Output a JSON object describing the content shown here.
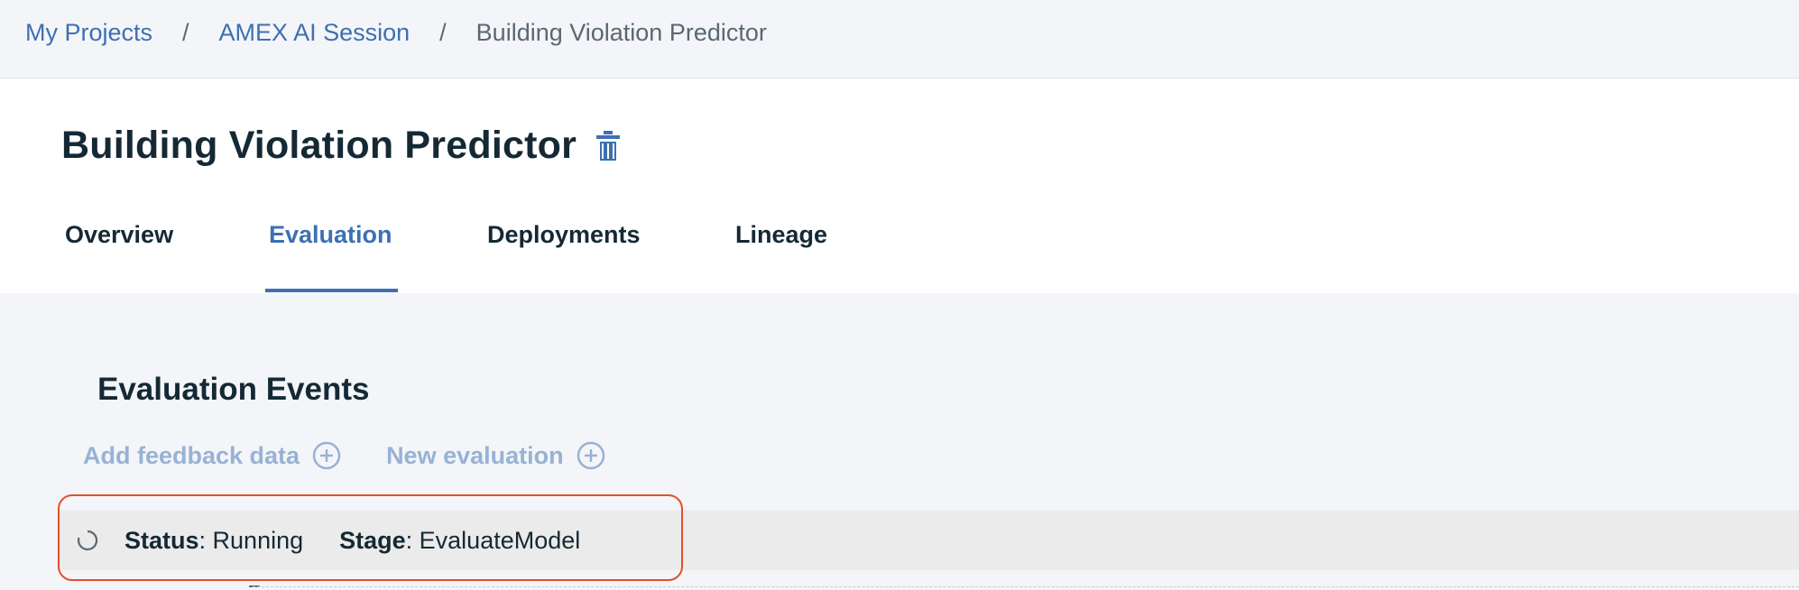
{
  "breadcrumb": {
    "items": [
      {
        "label": "My Projects"
      },
      {
        "label": "AMEX AI Session"
      },
      {
        "label": "Building Violation Predictor"
      }
    ],
    "separator": "/"
  },
  "header": {
    "title": "Building Violation Predictor",
    "delete_icon": "trash-icon"
  },
  "tabs": [
    {
      "label": "Overview"
    },
    {
      "label": "Evaluation",
      "active": true
    },
    {
      "label": "Deployments"
    },
    {
      "label": "Lineage"
    }
  ],
  "evaluation": {
    "section_title": "Evaluation Events",
    "actions": [
      {
        "label": "Add feedback data",
        "icon": "add-circle-icon"
      },
      {
        "label": "New evaluation",
        "icon": "add-circle-icon"
      }
    ],
    "status": {
      "icon": "spinner-icon",
      "status_label": "Status",
      "status_value": ": Running",
      "stage_label": "Stage",
      "stage_value": ": EvaluateModel"
    }
  },
  "colors": {
    "accent": "#3d70b2",
    "highlight_border": "#e0502e",
    "disabled_action": "#97b2d6"
  }
}
